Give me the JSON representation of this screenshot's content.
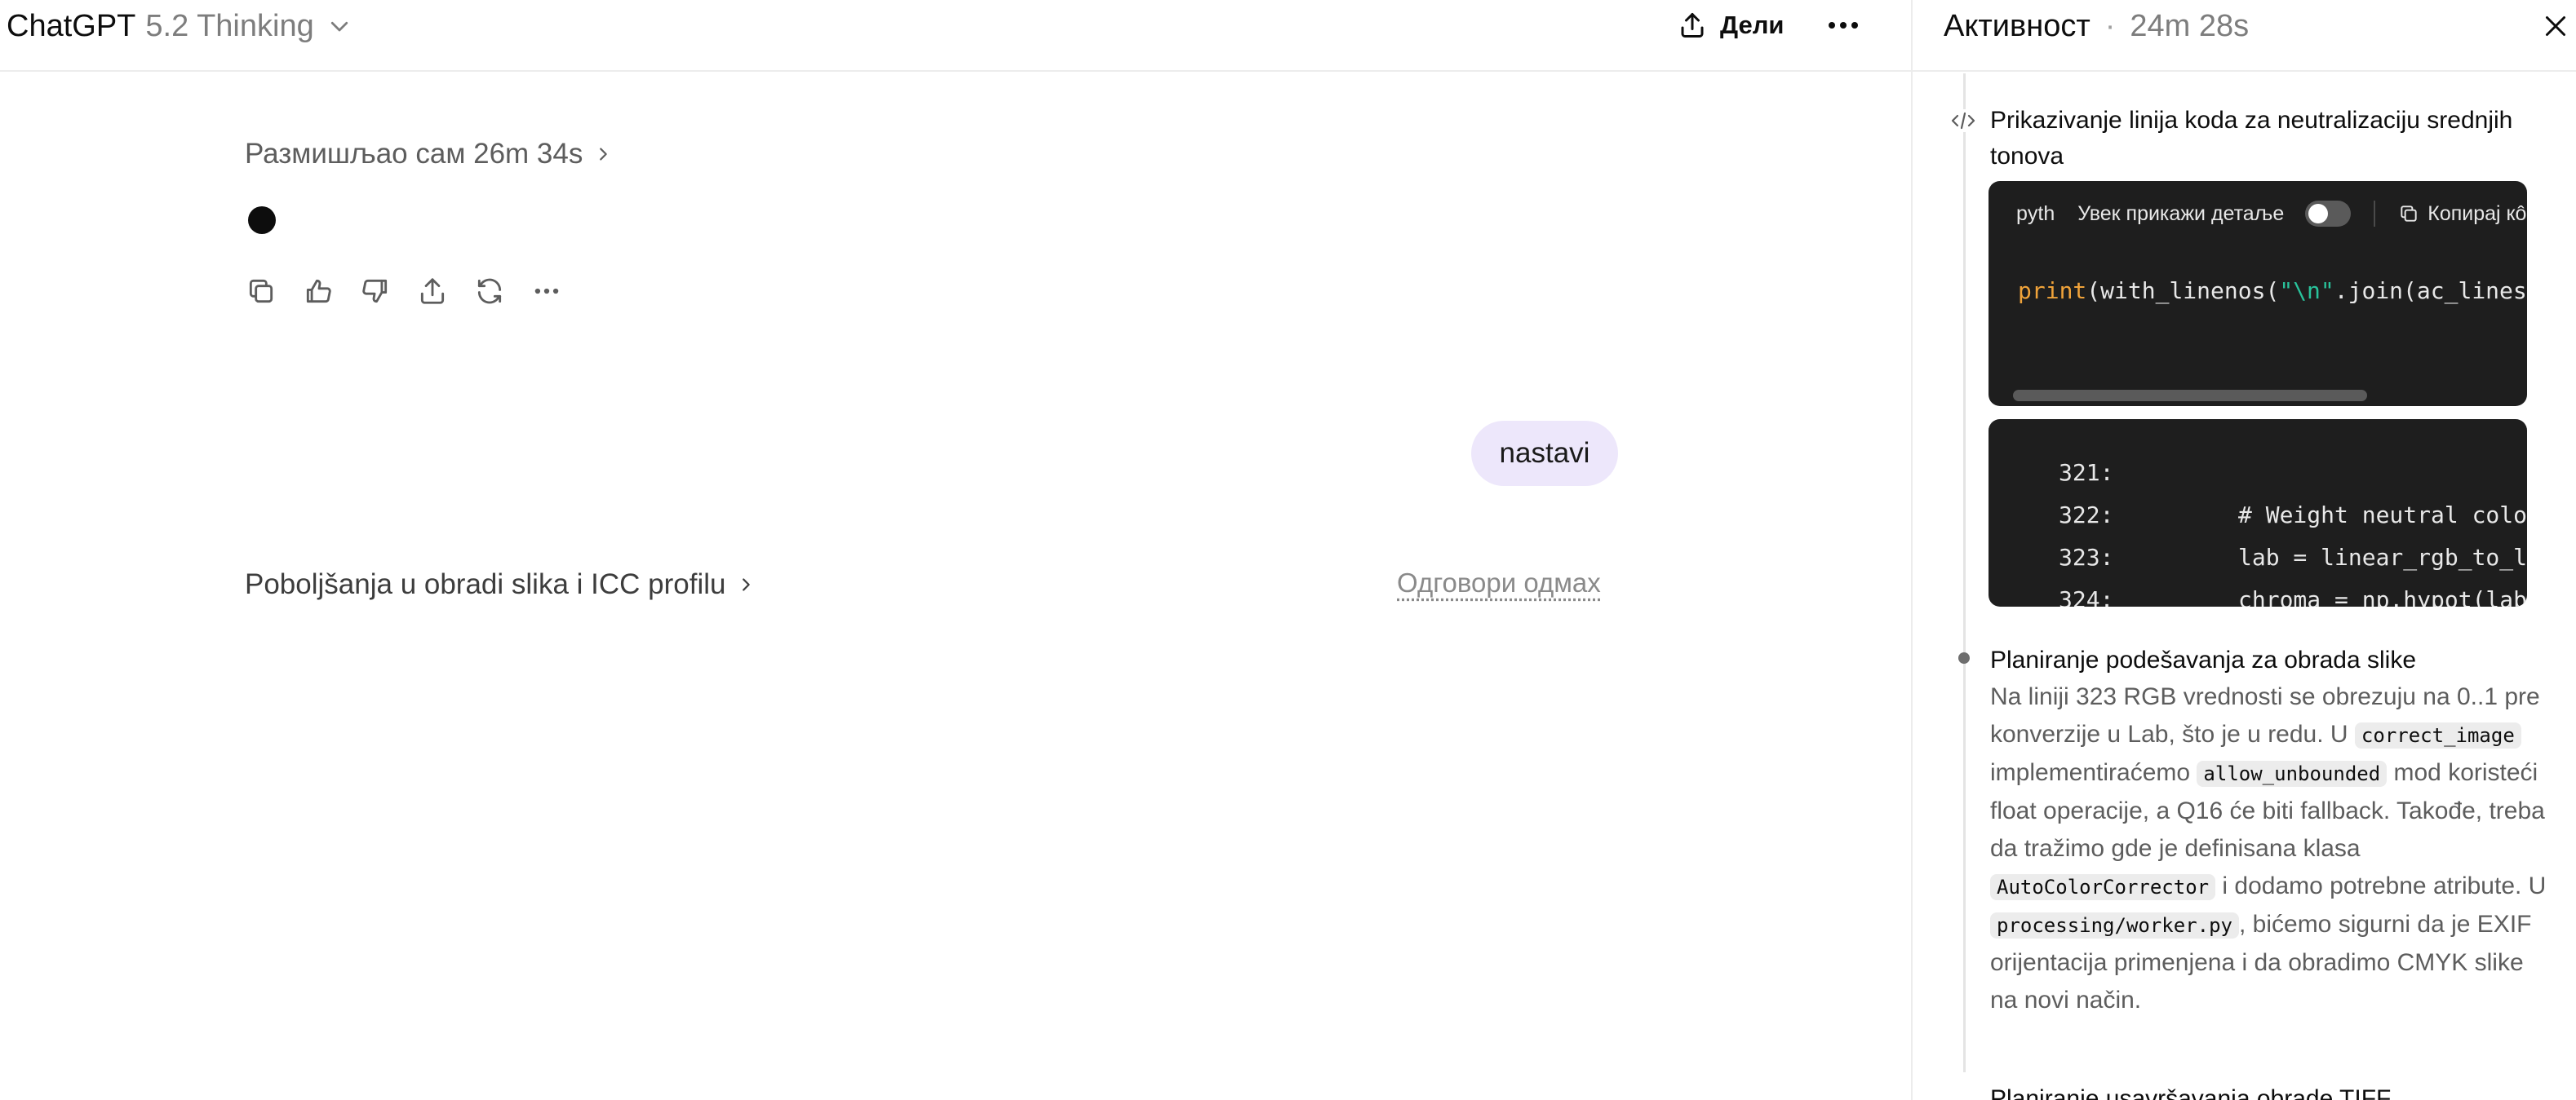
{
  "topbar": {
    "app_name": "ChatGPT",
    "model_name": "5.2 Thinking",
    "share_label": "Дели"
  },
  "conversation": {
    "thought_label": "Размишљао сам 26m 34s",
    "user_message": "nastavi",
    "suggestion": "Poboljšanja u obradi slika i ICC profilu",
    "answer_now": "Одговори одмах"
  },
  "activity": {
    "title": "Активност",
    "separator": "·",
    "duration": "24m 28s",
    "steps": [
      {
        "title": "Prikazivanje linija koda za neutralizaciju srednjih tonova",
        "code_lang": "pyth",
        "toggle_label": "Увек прикажи детаље",
        "copy_label": "Копирај кô",
        "code": {
          "fn": "print",
          "part1": "(with_linenos(",
          "str": "\"\\n\"",
          "part2": ".join(ac_lines["
        },
        "output": [
          {
            "ln": "321:",
            "src": ""
          },
          {
            "ln": "322:",
            "src": "# Weight neutral color"
          },
          {
            "ln": "323:",
            "src": "lab = linear_rgb_to_la"
          },
          {
            "ln": "324:",
            "src": "chroma = np.hypot(lab["
          }
        ]
      },
      {
        "title": "Planiranje podešavanja za obrada slike",
        "body": {
          "t1": "Na liniji 323 RGB vrednosti se obrezuju na 0..1 pre konverzije u Lab, što je u redu. U ",
          "c1": "correct_image",
          "t2": " implementiraćemo ",
          "c2": "allow_unbounded",
          "t3": " mod koristeći float operacije, a Q16 će biti fallback. Takođe, treba da tražimo gde je definisana klasa ",
          "c3": "AutoColorCorrector",
          "t4": " i dodamo potrebne atribute. U ",
          "c4": "processing/worker.py",
          "t5": ", bićemo sigurni da je EXIF orijentacija primenjena i da obradimo CMYK slike na novi način."
        }
      },
      {
        "title": "Planiranje usavršavanja obrade TIFF"
      }
    ]
  }
}
